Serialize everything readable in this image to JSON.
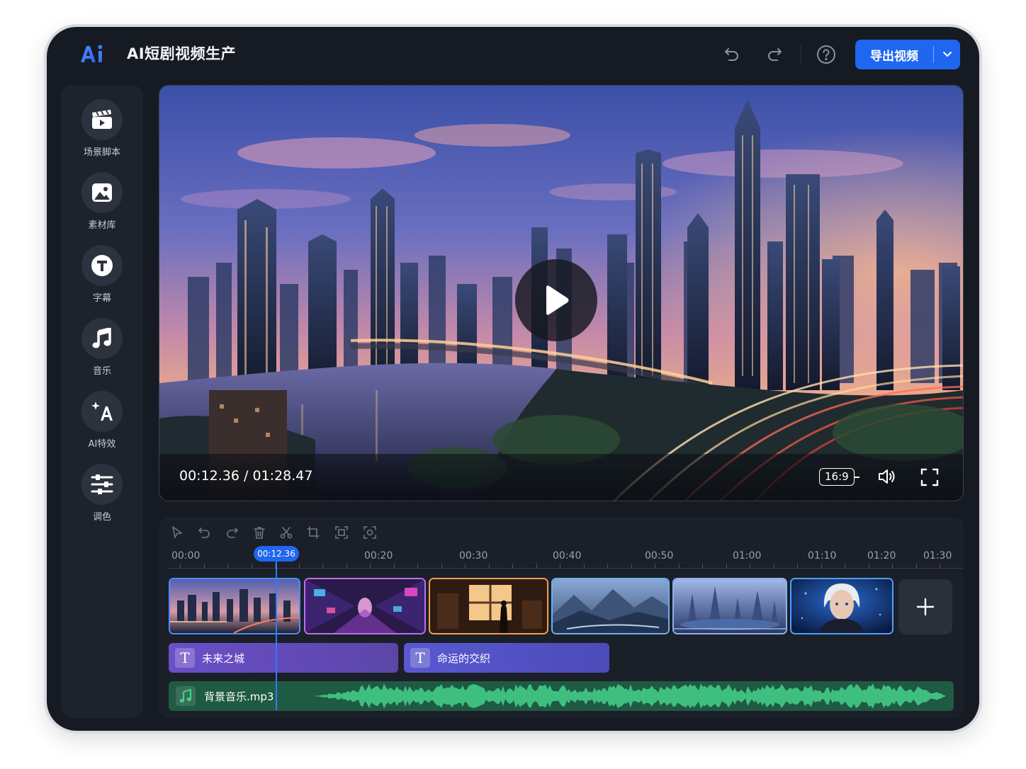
{
  "app": {
    "title": "AI短剧视频生产",
    "logo_text": "Ai"
  },
  "header": {
    "export_label": "导出视频",
    "accent_color": "#1f66f0"
  },
  "sidebar": {
    "items": [
      {
        "label": "场景脚本",
        "icon": "clapperboard-icon"
      },
      {
        "label": "素材库",
        "icon": "image-icon"
      },
      {
        "label": "字幕",
        "icon": "text-t-icon"
      },
      {
        "label": "音乐",
        "icon": "music-note-icon"
      },
      {
        "label": "AI特效",
        "icon": "ai-sparkle-icon"
      },
      {
        "label": "调色",
        "icon": "sliders-icon"
      }
    ]
  },
  "player": {
    "current_time": "00:12.36",
    "separator": "/",
    "total_time": "01:28.47",
    "aspect_ratio": "16:9"
  },
  "timeline": {
    "ticks": [
      "00:00",
      "00:20",
      "00:30",
      "00:40",
      "00:50",
      "01:00",
      "01:10",
      "01:20",
      "01:30"
    ],
    "playhead_time": "00:12.36",
    "clips": [
      {
        "scene": "city-skyline-dusk"
      },
      {
        "scene": "neon-street"
      },
      {
        "scene": "window-room-silhouette"
      },
      {
        "scene": "misty-mountains"
      },
      {
        "scene": "futuristic-city"
      },
      {
        "scene": "character-portrait"
      }
    ],
    "subtitles": [
      {
        "text": "未来之城"
      },
      {
        "text": "命运的交织"
      }
    ],
    "audio": {
      "label": "背景音乐.mp3"
    }
  }
}
